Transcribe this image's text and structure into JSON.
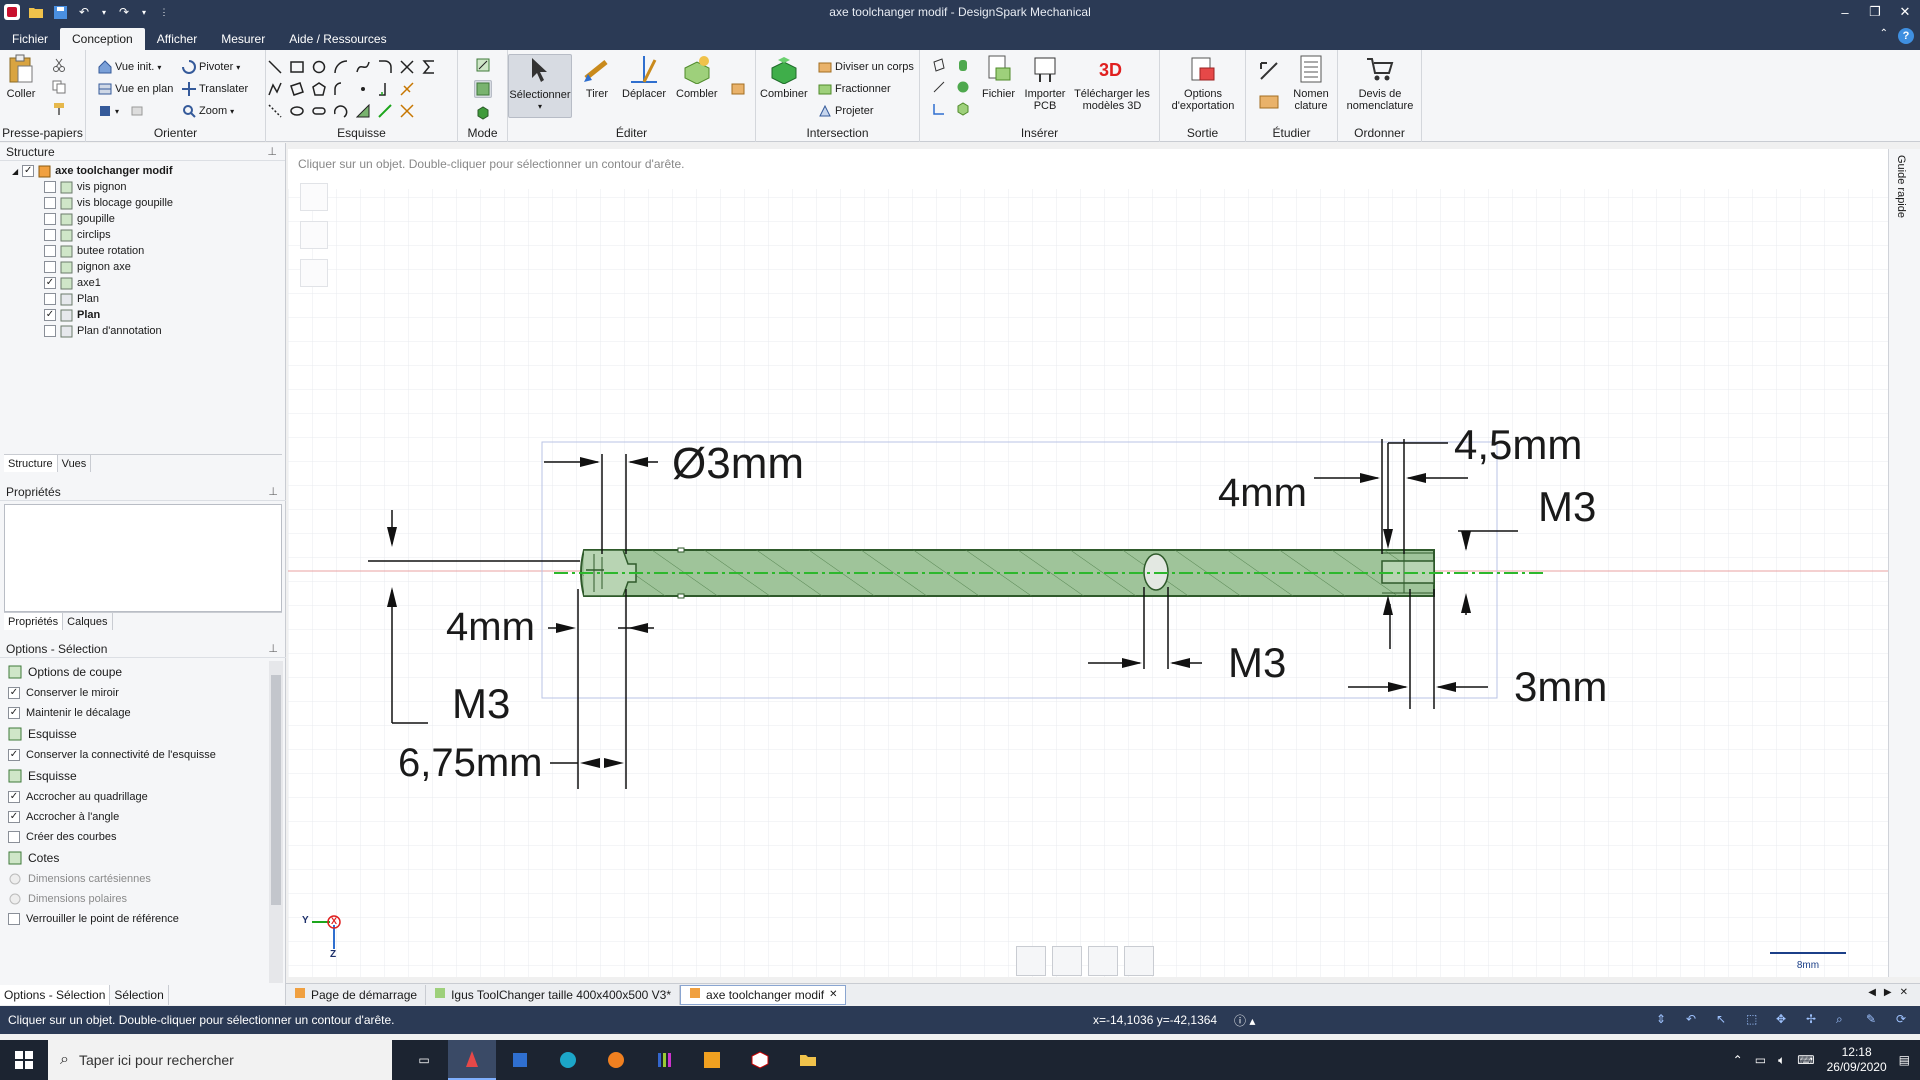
{
  "window": {
    "title": "axe toolchanger modif - DesignSpark Mechanical"
  },
  "menu": {
    "tabs": [
      "Fichier",
      "Conception",
      "Afficher",
      "Mesurer",
      "Aide / Ressources"
    ]
  },
  "ribbon": {
    "presse_papiers": {
      "label": "Presse-papiers",
      "coller": "Coller"
    },
    "orienter": {
      "label": "Orienter",
      "vue_init": "Vue init.",
      "vue_plan": "Vue en plan",
      "pivoter": "Pivoter",
      "translater": "Translater",
      "zoom": "Zoom"
    },
    "esquisse": {
      "label": "Esquisse"
    },
    "mode": {
      "label": "Mode"
    },
    "editer": {
      "label": "Éditer",
      "selectionner": "Sélectionner",
      "tirer": "Tirer",
      "deplacer": "Déplacer",
      "combler": "Combler"
    },
    "intersection": {
      "label": "Intersection",
      "combiner": "Combiner",
      "diviser": "Diviser un corps",
      "fractionner": "Fractionner",
      "projeter": "Projeter"
    },
    "inserer": {
      "label": "Insérer",
      "fichier": "Fichier",
      "importer_pcb": "Importer PCB",
      "telecharger": "Télécharger les modèles 3D"
    },
    "sortie": {
      "label": "Sortie",
      "options_export": "Options d'exportation"
    },
    "etudier": {
      "label": "Étudier",
      "nomenclature": "Nomen clature"
    },
    "ordonner": {
      "label": "Ordonner",
      "devis": "Devis de nomenclature"
    }
  },
  "structure": {
    "header": "Structure",
    "root": "axe toolchanger modif",
    "items": [
      {
        "label": "vis pignon",
        "checked": false
      },
      {
        "label": "vis blocage goupille",
        "checked": false
      },
      {
        "label": "goupille",
        "checked": false
      },
      {
        "label": "circlips",
        "checked": false
      },
      {
        "label": "butee rotation",
        "checked": false
      },
      {
        "label": "pignon axe",
        "checked": false
      },
      {
        "label": "axe1",
        "checked": true
      },
      {
        "label": "Plan",
        "checked": false
      },
      {
        "label": "Plan",
        "checked": true,
        "bold": true
      },
      {
        "label": "Plan d'annotation",
        "checked": false
      }
    ],
    "tabs": [
      "Structure",
      "Vues"
    ]
  },
  "properties": {
    "header": "Propriétés",
    "tabs": [
      "Propriétés",
      "Calques"
    ]
  },
  "options": {
    "header": "Options - Sélection",
    "sections": [
      {
        "title": "Options de coupe",
        "items": [
          {
            "label": "Conserver le miroir",
            "checked": true
          },
          {
            "label": "Maintenir le décalage",
            "checked": true
          }
        ]
      },
      {
        "title": "Esquisse",
        "items": [
          {
            "label": "Conserver la connectivité de l'esquisse",
            "checked": true
          }
        ]
      },
      {
        "title": "Esquisse",
        "items": [
          {
            "label": "Accrocher au quadrillage",
            "checked": true
          },
          {
            "label": "Accrocher à l'angle",
            "checked": true
          },
          {
            "label": "Créer des courbes",
            "checked": false
          }
        ]
      },
      {
        "title": "Cotes",
        "items": [
          {
            "label": "Dimensions cartésiennes",
            "disabled": true
          },
          {
            "label": "Dimensions polaires",
            "disabled": true
          },
          {
            "label": "Verrouiller le point de référence",
            "checked": false
          }
        ]
      }
    ],
    "bottom_tabs": [
      "Options - Sélection",
      "Sélection"
    ]
  },
  "canvas": {
    "hint": "Cliquer sur un objet. Double-cliquer pour sélectionner un contour d'arête.",
    "dims": {
      "d_dia": "Ø3mm",
      "d_45": "4,5mm",
      "d_4top": "4mm",
      "d_m3right": "M3",
      "d_4left": "4mm",
      "d_m3mid": "M3",
      "d_m3left": "M3",
      "d_3mm": "3mm",
      "d_675": "6,75mm"
    },
    "scale": "8mm",
    "axis_y": "Y",
    "axis_x": "X",
    "axis_z": "Z",
    "guide": "Guide rapide"
  },
  "doc_tabs": [
    {
      "label": "Page de démarrage",
      "active": false
    },
    {
      "label": "Igus ToolChanger  taille 400x400x500 V3*",
      "active": false
    },
    {
      "label": "axe toolchanger modif",
      "active": true
    }
  ],
  "status": {
    "message": "Cliquer sur un objet. Double-cliquer pour sélectionner un contour d'arête.",
    "coords": "x=-14,1036  y=-42,1364"
  },
  "taskbar": {
    "search": "Taper ici pour rechercher",
    "time": "12:18",
    "date": "26/09/2020"
  },
  "colors": {
    "titlebar": "#2b3a55",
    "part_fill": "#9fc49a",
    "part_stroke": "#3f7a3a",
    "centerline": "#2db82d",
    "grid": "#e6e8ec"
  }
}
